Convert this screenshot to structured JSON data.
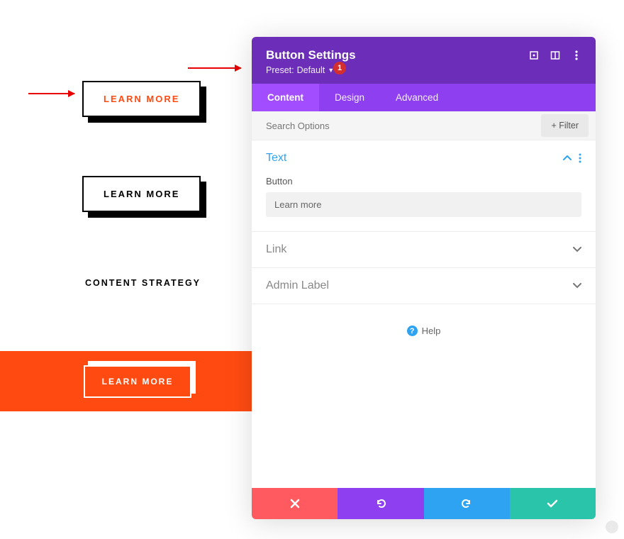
{
  "preview": {
    "btn1": "LEARN MORE",
    "btn2": "LEARN MORE",
    "strategy": "CONTENT STRATEGY",
    "btn3": "LEARN MORE"
  },
  "badge": "1",
  "panel": {
    "title": "Button Settings",
    "preset_label": "Preset:",
    "preset_value": "Default",
    "tabs": [
      "Content",
      "Design",
      "Advanced"
    ],
    "search_placeholder": "Search Options",
    "filter_label": "Filter",
    "sections": {
      "text": {
        "title": "Text",
        "field_label": "Button",
        "field_value": "Learn more"
      },
      "link": {
        "title": "Link"
      },
      "admin": {
        "title": "Admin Label"
      }
    },
    "help": "Help"
  }
}
